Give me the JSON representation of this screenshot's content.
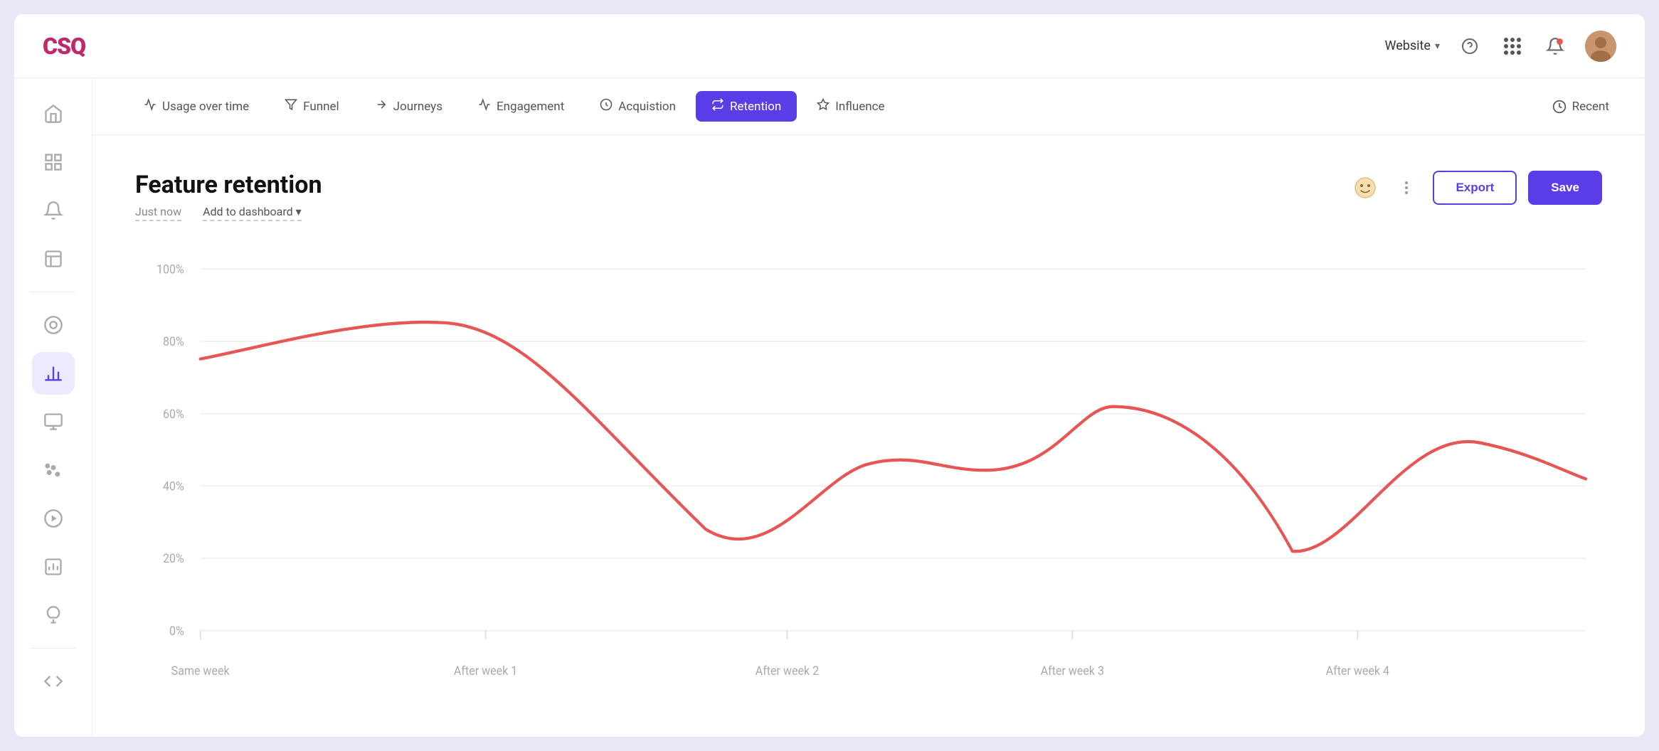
{
  "header": {
    "logo": "CSQ",
    "website_label": "Website",
    "help_icon": "?",
    "avatar_initials": "👤"
  },
  "sidebar": {
    "items": [
      {
        "id": "home",
        "icon": "⌂",
        "active": false
      },
      {
        "id": "grid",
        "icon": "⊞",
        "active": false
      },
      {
        "id": "bell",
        "icon": "🔔",
        "active": false
      },
      {
        "id": "layout",
        "icon": "▤",
        "active": false
      },
      {
        "id": "chart-donut",
        "icon": "◎",
        "active": false
      },
      {
        "id": "bar-chart",
        "icon": "📊",
        "active": true
      },
      {
        "id": "screen",
        "icon": "▢",
        "active": false
      },
      {
        "id": "scatter",
        "icon": "⠿",
        "active": false
      },
      {
        "id": "play",
        "icon": "▶",
        "active": false
      },
      {
        "id": "bar-report",
        "icon": "📉",
        "active": false
      },
      {
        "id": "bulb",
        "icon": "💡",
        "active": false
      },
      {
        "id": "code",
        "icon": "⊞",
        "active": false
      }
    ]
  },
  "nav": {
    "tabs": [
      {
        "id": "usage",
        "label": "Usage over time",
        "active": false
      },
      {
        "id": "funnel",
        "label": "Funnel",
        "active": false
      },
      {
        "id": "journeys",
        "label": "Journeys",
        "active": false
      },
      {
        "id": "engagement",
        "label": "Engagement",
        "active": false
      },
      {
        "id": "acquisition",
        "label": "Acquistion",
        "active": false
      },
      {
        "id": "retention",
        "label": "Retention",
        "active": true
      },
      {
        "id": "influence",
        "label": "Influence",
        "active": false
      }
    ],
    "recent_label": "Recent"
  },
  "chart": {
    "title": "Feature retention",
    "timestamp": "Just now",
    "add_dashboard_label": "Add to dashboard",
    "export_label": "Export",
    "save_label": "Save",
    "y_labels": [
      "100%",
      "80%",
      "60%",
      "40%",
      "20%",
      "0%"
    ],
    "x_labels": [
      "Same week",
      "After week 1",
      "After week 2",
      "After week 3",
      "After week 4"
    ],
    "accent_color": "#e85555",
    "grid_color": "#f0f0f0"
  }
}
